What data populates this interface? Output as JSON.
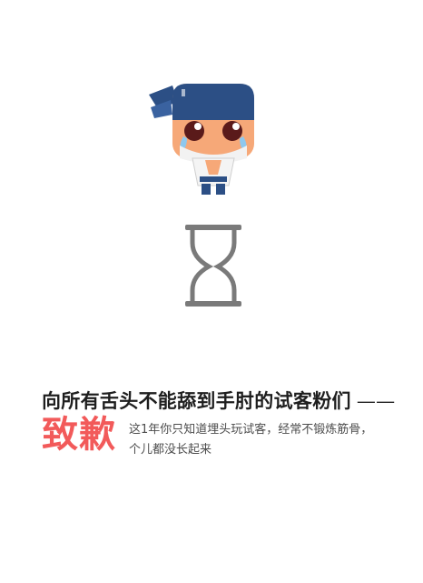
{
  "message": {
    "headline": "向所有舌头不能舔到手肘的试客粉们",
    "dash": "——",
    "apology": "致歉",
    "detail_line1": "这1年你只知道埋头玩试客，经常不锻炼筋骨，",
    "detail_line2": "个儿都没长起来"
  },
  "icons": {
    "mascot": "crying-ninja-mascot-icon",
    "hourglass": "hourglass-icon"
  },
  "colors": {
    "accent": "#f25a5a",
    "headline": "#1e1e1e",
    "detail": "#4d4d4d",
    "hourglass": "#7a7a7a",
    "headband": "#2c4f85",
    "skin": "#f6a878"
  }
}
